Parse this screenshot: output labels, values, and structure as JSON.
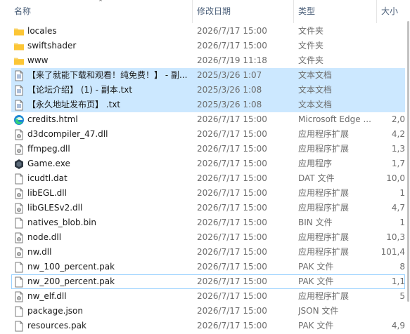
{
  "columns": {
    "name": "名称",
    "date": "修改日期",
    "type": "类型",
    "size": "大小"
  },
  "files": [
    {
      "name": "locales",
      "date": "2026/7/17 15:00",
      "type": "文件夹",
      "size": "",
      "icon": "folder-icon",
      "selected": false
    },
    {
      "name": "swiftshader",
      "date": "2026/7/17 15:00",
      "type": "文件夹",
      "size": "",
      "icon": "folder-icon",
      "selected": false
    },
    {
      "name": "www",
      "date": "2026/7/19 11:18",
      "type": "文件夹",
      "size": "",
      "icon": "folder-icon",
      "selected": false
    },
    {
      "name": "【来了就能下载和观看！纯免费！】 - 副...",
      "date": "2025/3/26 1:07",
      "type": "文本文档",
      "size": "",
      "icon": "text-file-icon",
      "selected": true
    },
    {
      "name": "【论坛介绍】 (1) - 副本.txt",
      "date": "2025/3/26 1:08",
      "type": "文本文档",
      "size": "",
      "icon": "text-file-icon",
      "selected": true
    },
    {
      "name": "【永久地址发布页】 .txt",
      "date": "2025/3/26 1:08",
      "type": "文本文档",
      "size": "",
      "icon": "text-file-icon",
      "selected": true
    },
    {
      "name": "credits.html",
      "date": "2026/7/17 15:00",
      "type": "Microsoft Edge ...",
      "size": "2,0",
      "icon": "edge-icon",
      "selected": false
    },
    {
      "name": "d3dcompiler_47.dll",
      "date": "2026/7/17 15:00",
      "type": "应用程序扩展",
      "size": "4,2",
      "icon": "dll-file-icon",
      "selected": false
    },
    {
      "name": "ffmpeg.dll",
      "date": "2026/7/17 15:00",
      "type": "应用程序扩展",
      "size": "1,3",
      "icon": "dll-file-icon",
      "selected": false
    },
    {
      "name": "Game.exe",
      "date": "2026/7/17 15:00",
      "type": "应用程序",
      "size": "1,7",
      "icon": "game-exe-icon",
      "selected": false
    },
    {
      "name": "icudtl.dat",
      "date": "2026/7/17 15:00",
      "type": "DAT 文件",
      "size": "10,0",
      "icon": "blank-file-icon",
      "selected": false
    },
    {
      "name": "libEGL.dll",
      "date": "2026/7/17 15:00",
      "type": "应用程序扩展",
      "size": "1",
      "icon": "dll-file-icon",
      "selected": false
    },
    {
      "name": "libGLESv2.dll",
      "date": "2026/7/17 15:00",
      "type": "应用程序扩展",
      "size": "4,7",
      "icon": "dll-file-icon",
      "selected": false
    },
    {
      "name": "natives_blob.bin",
      "date": "2026/7/17 15:00",
      "type": "BIN 文件",
      "size": "1",
      "icon": "blank-file-icon",
      "selected": false
    },
    {
      "name": "node.dll",
      "date": "2026/7/17 15:00",
      "type": "应用程序扩展",
      "size": "10,3",
      "icon": "dll-file-icon",
      "selected": false
    },
    {
      "name": "nw.dll",
      "date": "2026/7/17 15:00",
      "type": "应用程序扩展",
      "size": "101,4",
      "icon": "dll-file-icon",
      "selected": false
    },
    {
      "name": "nw_100_percent.pak",
      "date": "2026/7/17 15:00",
      "type": "PAK 文件",
      "size": "8",
      "icon": "blank-file-icon",
      "selected": false
    },
    {
      "name": "nw_200_percent.pak",
      "date": "2026/7/17 15:00",
      "type": "PAK 文件",
      "size": "1,1",
      "icon": "blank-file-icon",
      "selected": false,
      "focused": true
    },
    {
      "name": "nw_elf.dll",
      "date": "2026/7/17 15:00",
      "type": "应用程序扩展",
      "size": "5",
      "icon": "dll-file-icon",
      "selected": false
    },
    {
      "name": "package.json",
      "date": "2026/7/17 15:00",
      "type": "JSON 文件",
      "size": "",
      "icon": "blank-file-icon",
      "selected": false
    },
    {
      "name": "resources.pak",
      "date": "2026/7/17 15:00",
      "type": "PAK 文件",
      "size": "4,9",
      "icon": "blank-file-icon",
      "selected": false
    }
  ]
}
